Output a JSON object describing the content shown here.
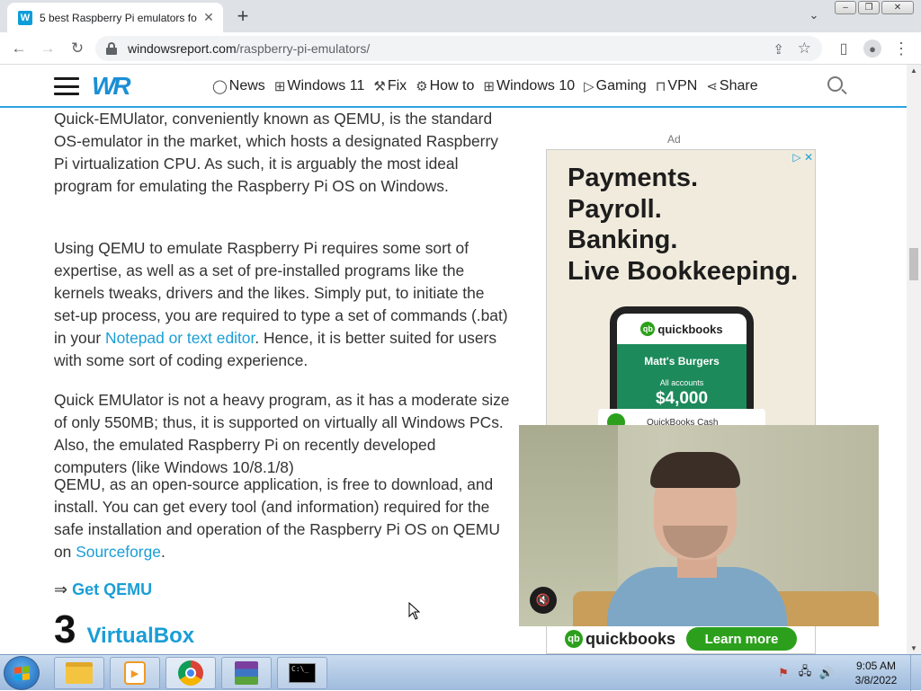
{
  "browser": {
    "tab_title": "5 best Raspberry Pi emulators fo",
    "tab_favicon": "W",
    "url_host": "windowsreport.com",
    "url_path": "/raspberry-pi-emulators/"
  },
  "site": {
    "logo": "WR",
    "nav": [
      {
        "icon": "chat-bubble-icon",
        "glyph": "◯",
        "label": "News"
      },
      {
        "icon": "windows-grid-icon",
        "glyph": "⊞",
        "label": "Windows 11"
      },
      {
        "icon": "wrench-icon",
        "glyph": "🔧",
        "label": "Fix"
      },
      {
        "icon": "gear-icon",
        "glyph": "⚙",
        "label": "How to"
      },
      {
        "icon": "windows-grid-icon",
        "glyph": "⊞",
        "label": "Windows 10"
      },
      {
        "icon": "play-icon",
        "glyph": "▷",
        "label": "Gaming"
      },
      {
        "icon": "lock-icon",
        "glyph": "🔒",
        "label": "VPN"
      },
      {
        "icon": "share-icon",
        "glyph": "⋖",
        "label": "Share"
      }
    ]
  },
  "article": {
    "p1": "Quick-EMUlator, conveniently known as QEMU, is the standard OS-emulator in the market, which hosts a designated Raspberry Pi virtualization CPU. As such, it is arguably the most ideal program for emulating the Raspberry Pi OS on Windows.",
    "p2_before": "Using QEMU to emulate Raspberry Pi requires some sort of expertise, as well as a set of pre-installed programs like the kernels tweaks, drivers and the likes. Simply put, to initiate the set-up process, you are required to type a set of commands (.bat) in your ",
    "p2_link": "Notepad or text editor",
    "p2_after": ". Hence, it is better suited for users with some sort of coding experience.",
    "p3": "Quick EMUlator is not a heavy program, as it has a moderate size of only 550MB; thus, it is supported on virtually all Windows PCs. Also, the emulated Raspberry Pi on recently developed computers (like Windows 10/8.1/8)",
    "p4_before": "QEMU, as an open-source application, is free to download, and install. You can get every tool (and information) required for the safe installation and operation of the Raspberry Pi OS on QEMU on ",
    "p4_link": "Sourceforge",
    "p4_after": ".",
    "get_arrow": "⇒",
    "get_link": "Get QEMU",
    "section_number": "3",
    "section_title": "VirtualBox"
  },
  "ad": {
    "label": "Ad",
    "headline_1": "Payments.",
    "headline_2": "Payroll.",
    "headline_3": "Banking.",
    "headline_4": "Live Bookkeeping.",
    "phone_brand": "quickbooks",
    "phone_company": "Matt's Burgers",
    "phone_accounts": "All accounts",
    "phone_amount": "$4,000",
    "card_text": "QuickBooks Cash",
    "logo_text": "quickbooks",
    "cta": "Learn more"
  },
  "taskbar": {
    "time": "9:05 AM",
    "date": "3/8/2022",
    "cmd_text": "C:\\_"
  }
}
